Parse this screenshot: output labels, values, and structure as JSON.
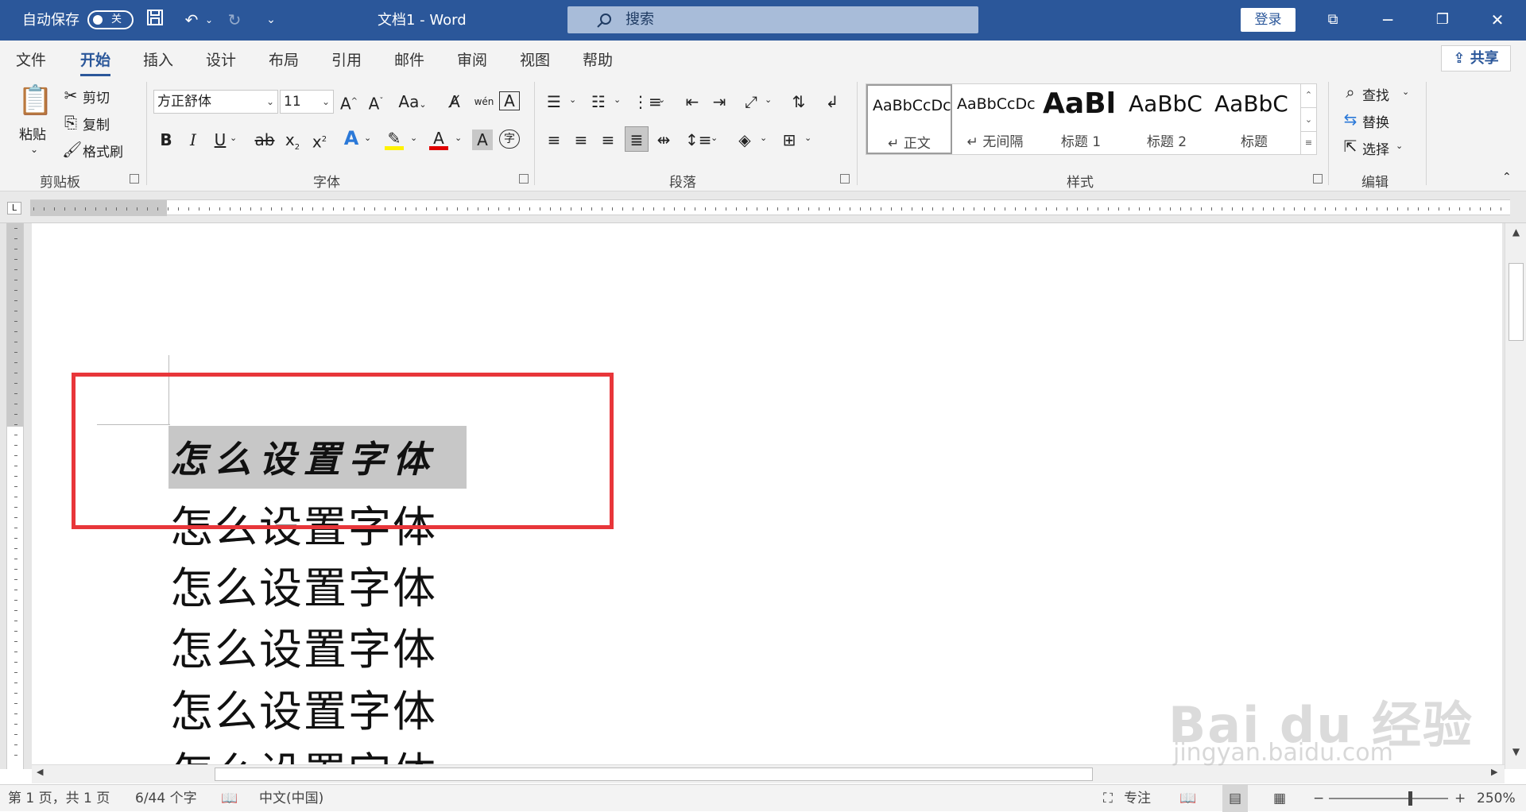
{
  "titlebar": {
    "autosave_label": "自动保存",
    "autosave_state": "关",
    "doc_title": "文档1  -  Word",
    "search_placeholder": "搜索",
    "login": "登录"
  },
  "menu": {
    "tabs": [
      "文件",
      "开始",
      "插入",
      "设计",
      "布局",
      "引用",
      "邮件",
      "审阅",
      "视图",
      "帮助"
    ],
    "active": "开始",
    "share": "共享"
  },
  "ribbon": {
    "clipboard": {
      "paste": "粘贴",
      "cut": "剪切",
      "copy": "复制",
      "format_painter": "格式刷",
      "group": "剪贴板"
    },
    "font": {
      "name": "方正舒体",
      "size": "11",
      "case_btn": "Aa",
      "group": "字体"
    },
    "paragraph": {
      "group": "段落"
    },
    "styles": {
      "group": "样式",
      "items": [
        {
          "preview": "AaBbCcDc",
          "name": "↵ 正文"
        },
        {
          "preview": "AaBbCcDc",
          "name": "↵ 无间隔"
        },
        {
          "preview": "AaBl",
          "name": "标题 1"
        },
        {
          "preview": "AaBbC",
          "name": "标题 2"
        },
        {
          "preview": "AaBbC",
          "name": "标题"
        }
      ]
    },
    "editing": {
      "find": "查找",
      "replace": "替换",
      "select": "选择",
      "group": "编辑"
    }
  },
  "document": {
    "lines": [
      "怎么设置字体",
      "怎么设置字体",
      "怎么设置字体",
      "怎么设置字体",
      "怎么设置字体",
      "怎么设置字体"
    ]
  },
  "status": {
    "page": "第 1 页，共 1 页",
    "words": "6/44 个字",
    "language": "中文(中国)",
    "focus": "专注",
    "zoom": "250%"
  },
  "watermark": {
    "brand": "Bai du 经验",
    "url": "jingyan.baidu.com"
  },
  "colors": {
    "title_bar": "#2b579a",
    "red_box": "#e8363a",
    "selection": "#c7c7c7"
  }
}
